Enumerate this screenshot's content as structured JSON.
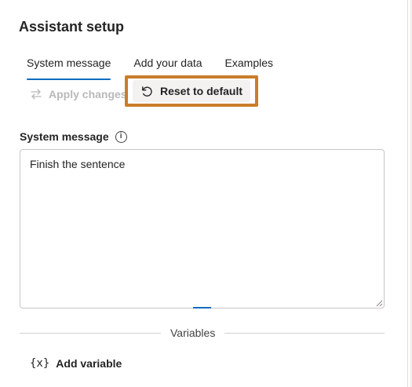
{
  "panel": {
    "title": "Assistant setup"
  },
  "tabs": [
    {
      "label": "System message",
      "active": true
    },
    {
      "label": "Add your data",
      "active": false
    },
    {
      "label": "Examples",
      "active": false
    }
  ],
  "toolbar": {
    "apply_label": "Apply changes",
    "apply_disabled": true,
    "reset_label": "Reset to default",
    "highlight_color": "#c97d2b"
  },
  "system_message": {
    "label": "System message",
    "value": "Finish the sentence"
  },
  "variables": {
    "section_label": "Variables",
    "add_label": "Add variable",
    "add_icon_glyph": "{x}"
  },
  "colors": {
    "accent": "#0f6cbd",
    "disabled_text": "#b9b9b9"
  }
}
